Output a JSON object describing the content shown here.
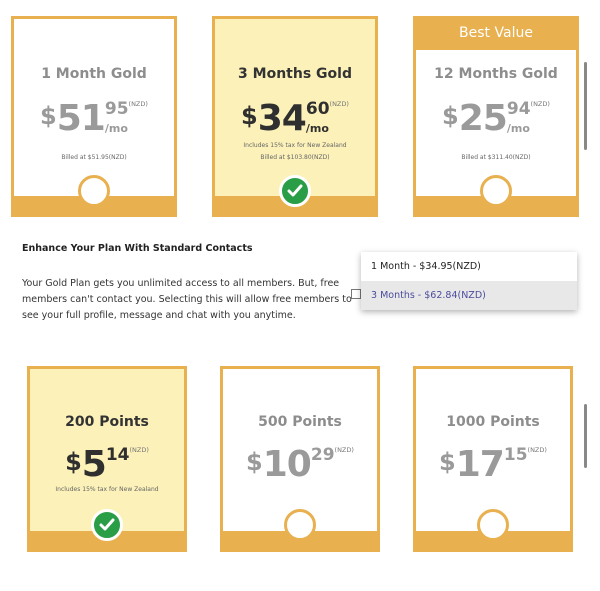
{
  "plans": [
    {
      "title": "1 Month Gold",
      "currency": "$",
      "amount_int": "51",
      "amount_dec": "95",
      "unit": "(NZD)",
      "per": "/mo",
      "tax_note": "",
      "billed": "Billed at $51.95(NZD)",
      "ribbon": "",
      "selected": false
    },
    {
      "title": "3 Months Gold",
      "currency": "$",
      "amount_int": "34",
      "amount_dec": "60",
      "unit": "(NZD)",
      "per": "/mo",
      "tax_note": "Includes 15% tax for New Zealand",
      "billed": "Billed at $103.80(NZD)",
      "ribbon": "",
      "selected": true
    },
    {
      "title": "12 Months Gold",
      "currency": "$",
      "amount_int": "25",
      "amount_dec": "94",
      "unit": "(NZD)",
      "per": "/mo",
      "tax_note": "",
      "billed": "Billed at $311.40(NZD)",
      "ribbon": "Best Value",
      "selected": false
    }
  ],
  "enhance": {
    "title": "Enhance Your Plan With Standard Contacts",
    "body": "Your Gold Plan gets you unlimited access to all members. But, free members can't contact you. Selecting this will allow free members to see your full profile, message and chat with you anytime.",
    "options": [
      "1 Month - $34.95(NZD)",
      "3 Months - $62.84(NZD)"
    ],
    "highlighted_option": 1,
    "checked": false
  },
  "points": [
    {
      "title": "200 Points",
      "currency": "$",
      "amount_int": "5",
      "amount_dec": "14",
      "unit": "(NZD)",
      "tax_note": "Includes 15% tax for New Zealand",
      "selected": true
    },
    {
      "title": "500 Points",
      "currency": "$",
      "amount_int": "10",
      "amount_dec": "29",
      "unit": "(NZD)",
      "tax_note": "",
      "selected": false
    },
    {
      "title": "1000 Points",
      "currency": "$",
      "amount_int": "17",
      "amount_dec": "15",
      "unit": "(NZD)",
      "tax_note": "",
      "selected": false
    }
  ],
  "colors": {
    "accent": "#e8b04f",
    "selected_bg": "#fbf1b9",
    "check_green": "#2a9d47",
    "highlight_text": "#4c4c9e"
  },
  "icons": {
    "selected": "checkmark-icon",
    "unselected": "radio-circle-icon"
  }
}
